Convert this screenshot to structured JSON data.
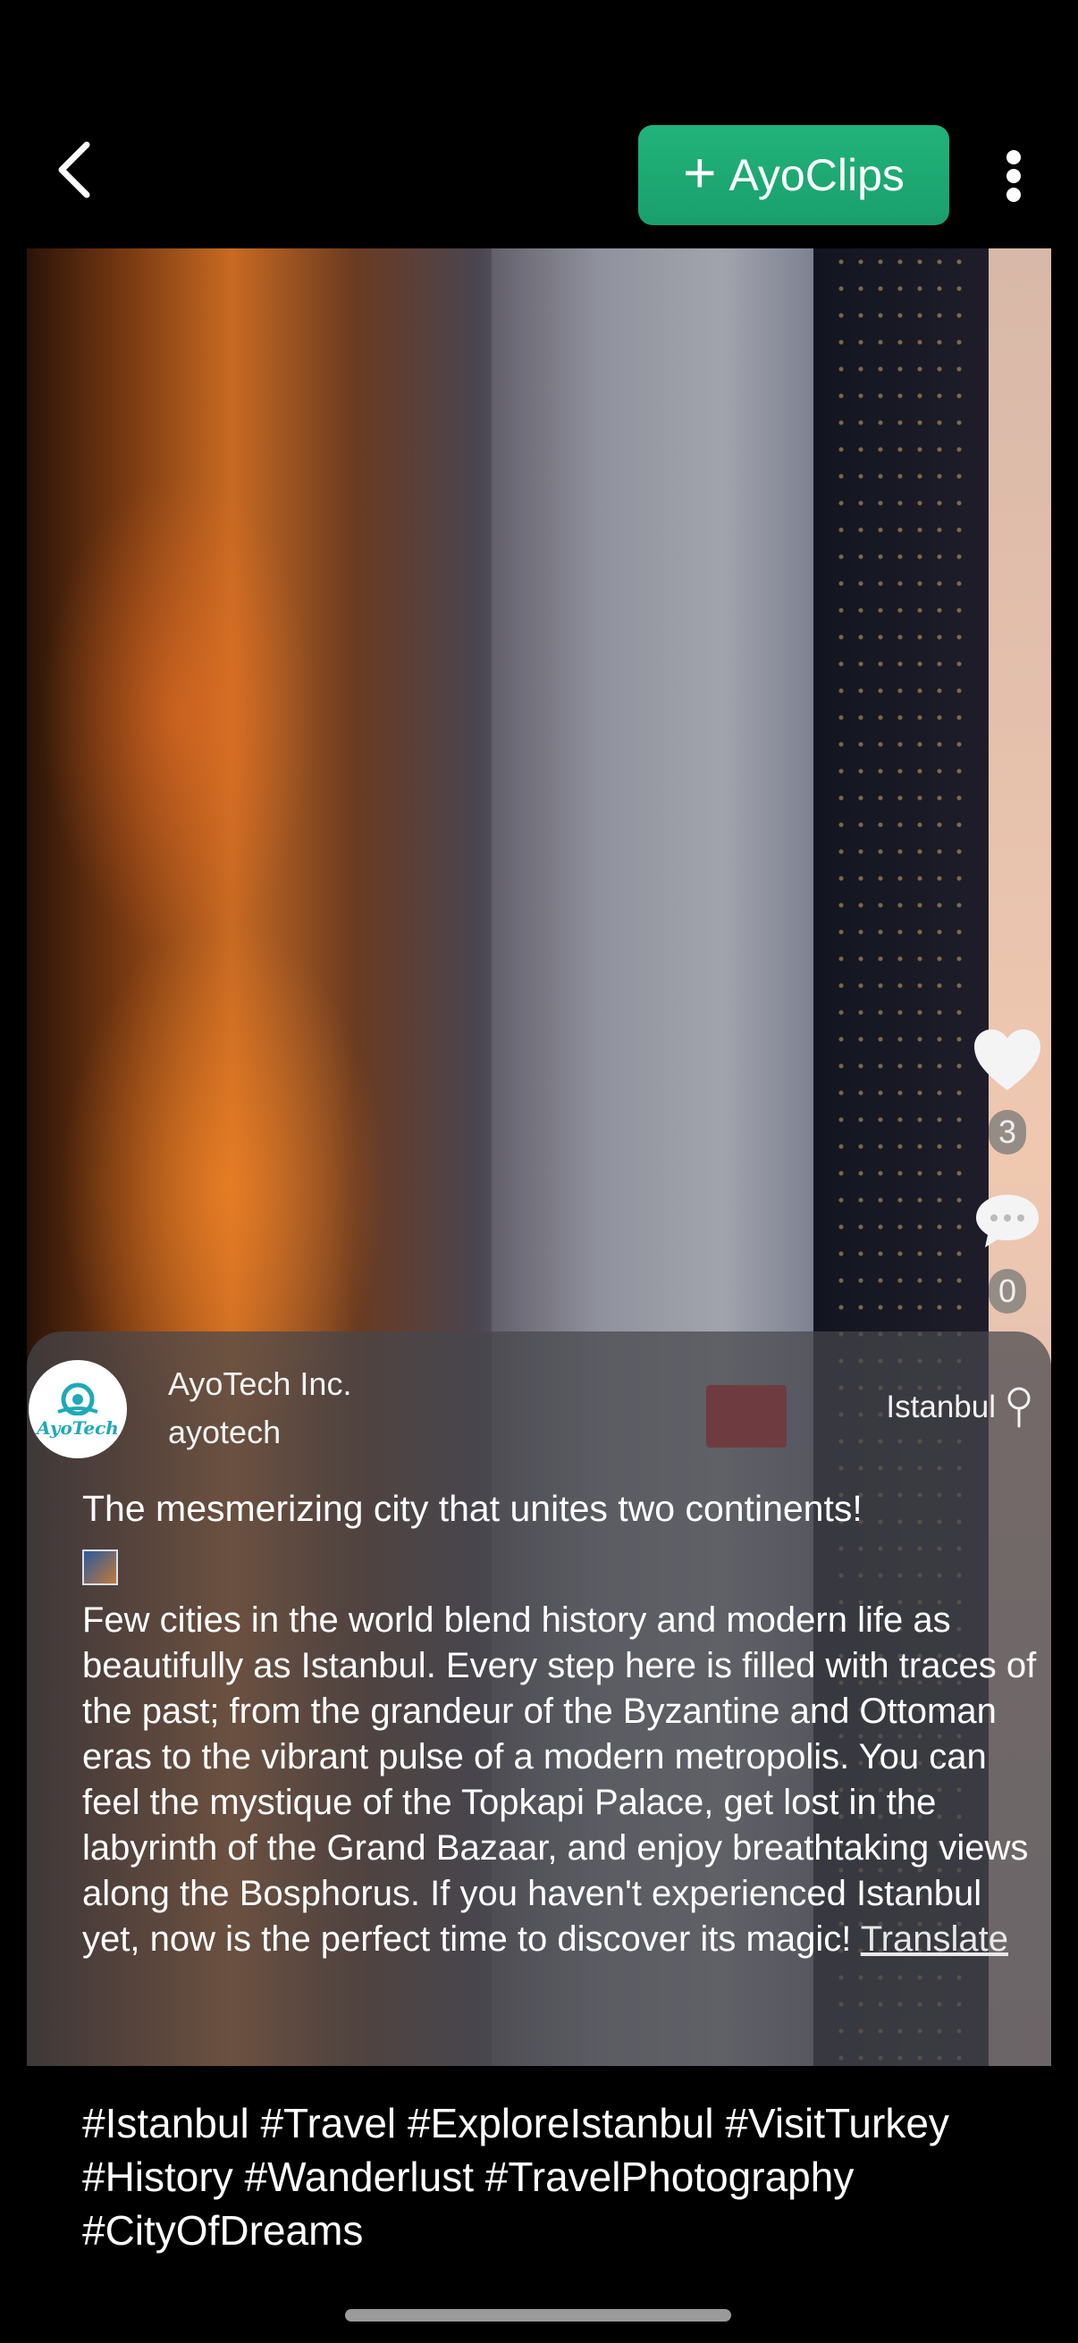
{
  "topbar": {
    "back_icon": "chevron-left-icon",
    "clips_button_label": "AyoClips",
    "clips_button_color": "#1fa870",
    "more_icon": "kebab-vertical-icon"
  },
  "actions": {
    "like_icon": "heart-icon",
    "like_count": "3",
    "comment_icon": "speech-bubble-icon",
    "comment_count": "0"
  },
  "author": {
    "avatar_text": "AyoTech",
    "name": "AyoTech Inc.",
    "handle": "ayotech"
  },
  "location": {
    "name": "Istanbul",
    "icon": "location-pin-icon"
  },
  "caption": {
    "title": "The mesmerizing city that unites two continents!",
    "body": "Few cities in the world blend history and modern life as beautifully as Istanbul. Every step here is filled with traces of the past; from the grandeur of the Byzantine and Ottoman eras to the vibrant pulse of a modern metropolis. You can feel the mystique of the Topkapi Palace, get lost in the labyrinth of the Grand Bazaar, and enjoy breathtaking views along the Bosphorus. If you haven't experienced Istanbul yet, now is the perfect time to discover its magic!",
    "translate_label": "Translate"
  },
  "hashtags": "#Istanbul #Travel #ExploreIstanbul #VisitTurkey #History #Wanderlust #TravelPhotography #CityOfDreams"
}
